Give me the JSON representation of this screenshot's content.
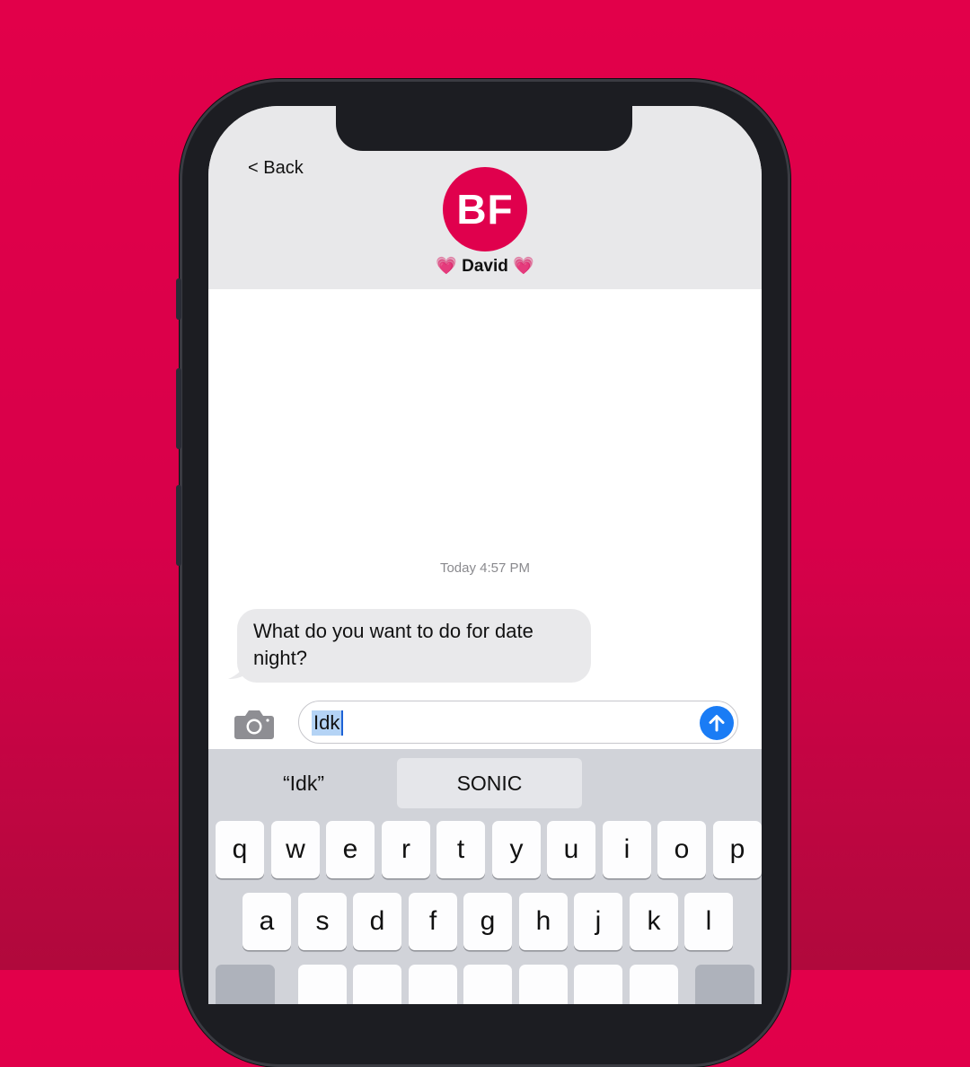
{
  "nav": {
    "back_label": "< Back"
  },
  "contact": {
    "initials": "BF",
    "name": "💗 David 💗",
    "avatar_color": "#e0004d"
  },
  "conversation": {
    "timestamp": "Today 4:57 PM",
    "messages": [
      {
        "text": "What do you want to do for date night?",
        "direction": "incoming"
      }
    ]
  },
  "composer": {
    "input_value": "Idk",
    "camera_icon": "camera-icon",
    "send_icon": "send-arrow-icon",
    "send_color": "#1a7cf5"
  },
  "keyboard": {
    "suggestions": [
      "“Idk”",
      "SONIC"
    ],
    "row1": [
      "q",
      "w",
      "e",
      "r",
      "t",
      "y",
      "u",
      "i",
      "o",
      "p"
    ],
    "row2": [
      "a",
      "s",
      "d",
      "f",
      "g",
      "h",
      "j",
      "k",
      "l"
    ]
  },
  "colors": {
    "background": "#e2004a",
    "bubble": "#e9e9eb"
  }
}
